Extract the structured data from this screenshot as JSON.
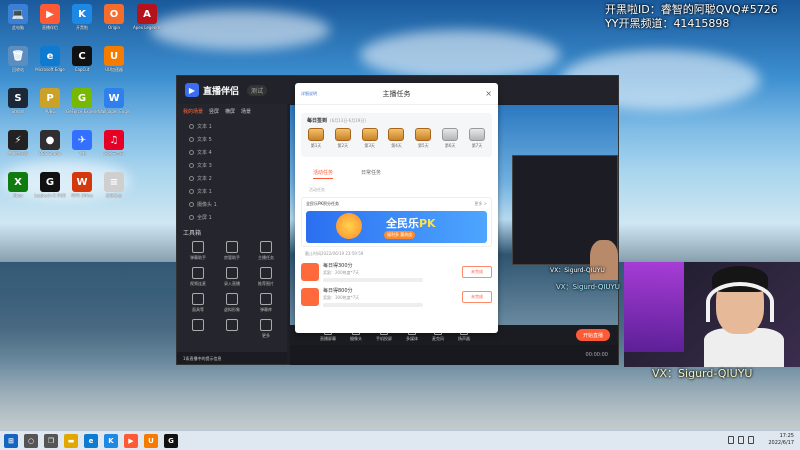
{
  "overlay": {
    "line1": "开黑啦ID：睿智的阿聪QVQ#5726",
    "line2": "YY开黑频道：41415898",
    "wechat": "VX：Sigurd-QIUYU",
    "preview_wechat": "VX：Sigurd-QIUYU"
  },
  "desktop": {
    "icons": [
      {
        "label": "此电脑",
        "glyph": "💻",
        "color": "#3d7fd6"
      },
      {
        "label": "直播伴侣",
        "glyph": "▶",
        "color": "#ff5a36"
      },
      {
        "label": "开黑啦",
        "glyph": "K",
        "color": "#1e88e5"
      },
      {
        "label": "Origin",
        "glyph": "O",
        "color": "#f56c2d"
      },
      {
        "label": "Apex Legends",
        "glyph": "A",
        "color": "#b5121b"
      },
      {
        "label": "回收站",
        "glyph": "🗑",
        "color": "#5b8dbf"
      },
      {
        "label": "Microsoft Edge",
        "glyph": "e",
        "color": "#0f7bd0"
      },
      {
        "label": "CapCut",
        "glyph": "C",
        "color": "#111111"
      },
      {
        "label": "UU加速器",
        "glyph": "U",
        "color": "#f57c00"
      },
      {
        "label": "Steam",
        "glyph": "S",
        "color": "#1b2838"
      },
      {
        "label": "PUBG",
        "glyph": "P",
        "color": "#c9a227"
      },
      {
        "label": "GeForce Experience",
        "glyph": "G",
        "color": "#76b900"
      },
      {
        "label": "Wallpaper Engine",
        "glyph": "W",
        "color": "#2f80ed"
      },
      {
        "label": "雷神加速器",
        "glyph": "⚡",
        "color": "#222222"
      },
      {
        "label": "OBS Studio",
        "glyph": "●",
        "color": "#302e31"
      },
      {
        "label": "飞书",
        "glyph": "✈",
        "color": "#3370ff"
      },
      {
        "label": "网易云音乐",
        "glyph": "♫",
        "color": "#e60026"
      },
      {
        "label": "Xbox",
        "glyph": "X",
        "color": "#107c10"
      },
      {
        "label": "Logitech G HUB",
        "glyph": "G",
        "color": "#111111"
      },
      {
        "label": "WPS Office",
        "glyph": "W",
        "color": "#d4380d"
      },
      {
        "label": "新建文本",
        "glyph": "≡",
        "color": "#cfcfcf"
      }
    ]
  },
  "app": {
    "title": "直播伴侣",
    "version": "测试",
    "sidebar_tabs": [
      "我的场景",
      "竖屏",
      "横屏",
      "场景"
    ],
    "scenes": [
      "文本 1",
      "文本 5",
      "文本 4",
      "文本 3",
      "文本 2",
      "文本 1",
      "摄像头 1",
      "全屏 1"
    ],
    "tools_title": "工具箱",
    "tools": [
      "弹幕助手",
      "房管助手",
      "主播任务",
      "视频连麦",
      "录入直播",
      "推荐图片",
      "面具等",
      "虚拟形象",
      "弹幕库",
      "",
      "",
      "更多"
    ],
    "footer": "1条直播中的提示信息",
    "bottom_buttons": [
      "直播屏幕",
      "摄像头",
      "手机投屏",
      "多媒体",
      "麦克风",
      "扬声器"
    ],
    "start_button": "开始直播",
    "status_time": "00:00:00"
  },
  "modal": {
    "help_link": "详细说明",
    "title": "主播任务",
    "checkin_title": "每日签到",
    "checkin_range": "(6月13日-6月19日)",
    "days": [
      "第1天",
      "第2天",
      "第3天",
      "第4天",
      "第5天",
      "第6天",
      "第7天"
    ],
    "tabs": [
      "活动任务",
      "日常任务"
    ],
    "sub_label": "活动任务",
    "task_title": "全民乐PK积分任务",
    "task_more": "更多 >",
    "banner_title_a": "全民乐",
    "banner_title_b": "PK",
    "banner_sub": "福利多 赢热度",
    "deadline": "截止时间2022/06/19 23:59:59",
    "rewards": [
      {
        "title": "每日得300分",
        "sub": "奖励：200热度*7天",
        "button": "未完成"
      },
      {
        "title": "每日得800分",
        "sub": "奖励：300热度*7天",
        "button": "未完成"
      }
    ]
  },
  "taskbar": {
    "time": "17:25",
    "date": "2022/6/17",
    "apps": [
      {
        "name": "start",
        "glyph": "⊞",
        "color": "#1565c0"
      },
      {
        "name": "search",
        "glyph": "○",
        "color": "#555555"
      },
      {
        "name": "task-view",
        "glyph": "❐",
        "color": "#555555"
      },
      {
        "name": "file-explorer",
        "glyph": "▬",
        "color": "#e0a800"
      },
      {
        "name": "edge",
        "glyph": "e",
        "color": "#0f7bd0"
      },
      {
        "name": "kaiheila",
        "glyph": "K",
        "color": "#1e88e5"
      },
      {
        "name": "live-companion",
        "glyph": "▶",
        "color": "#ff5a36"
      },
      {
        "name": "uu-accelerator",
        "glyph": "U",
        "color": "#f57c00"
      },
      {
        "name": "logitech",
        "glyph": "G",
        "color": "#111111"
      }
    ]
  }
}
